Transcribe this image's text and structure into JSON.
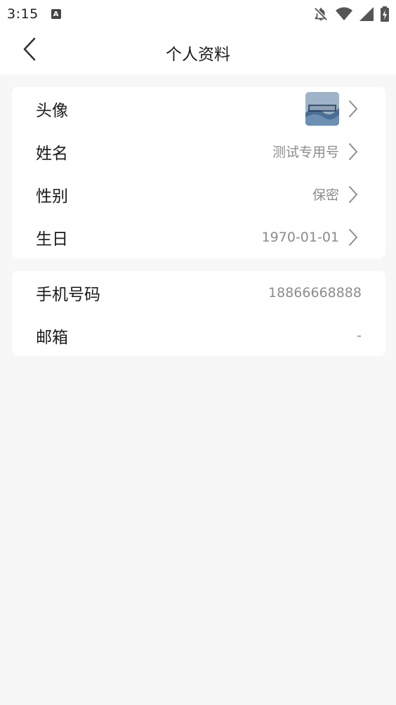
{
  "status_bar": {
    "time": "3:15",
    "notification_icon": "A",
    "icons": [
      "bell-off-icon",
      "wifi-icon",
      "signal-icon",
      "battery-charging-icon"
    ]
  },
  "nav": {
    "back_icon": "chevron-left-icon",
    "title": "个人资料"
  },
  "profile_section": {
    "rows": [
      {
        "label": "头像",
        "value": "",
        "has_avatar": true,
        "chevron": true
      },
      {
        "label": "姓名",
        "value": "测试专用号",
        "chevron": true
      },
      {
        "label": "性别",
        "value": "保密",
        "chevron": true
      },
      {
        "label": "生日",
        "value": "1970-01-01",
        "chevron": true
      }
    ]
  },
  "contact_section": {
    "rows": [
      {
        "label": "手机号码",
        "value": "18866668888",
        "chevron": false
      },
      {
        "label": "邮箱",
        "value": "-",
        "chevron": false
      }
    ]
  },
  "colors": {
    "background": "#f7f7f7",
    "card": "#ffffff",
    "label_text": "#1a1a1a",
    "value_text": "#8c8c8c"
  }
}
